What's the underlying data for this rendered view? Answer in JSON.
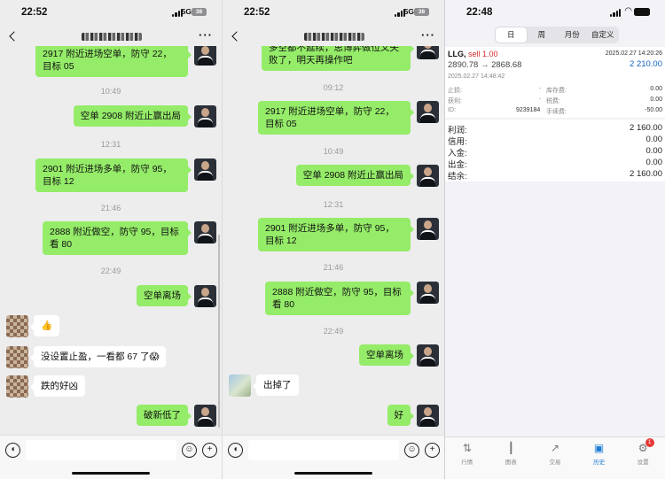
{
  "left_screen": {
    "status_time": "22:52",
    "network": "5G",
    "battery": "38",
    "more": "···",
    "timestamps": [
      "10:49",
      "12:31",
      "21:46",
      "22:49"
    ],
    "messages": [
      {
        "text": "2917 附近进场空单，防守 22，目标 05"
      },
      {
        "text": "空单 2908 附近止赢出局"
      },
      {
        "text": "2901 附近进场多单，防守 95，目标 12"
      },
      {
        "text": "2888 附近做空，防守 95，目标看 80"
      },
      {
        "text": "空单离场"
      },
      {
        "text": "👍"
      },
      {
        "text": "没设置止盈，一看都 67 了😱"
      },
      {
        "text": "跌的好凶"
      },
      {
        "text": "破新低了"
      }
    ]
  },
  "middle_screen": {
    "status_time": "22:52",
    "network": "5G",
    "battery": "38",
    "more": "···",
    "timestamps": [
      "09:12",
      "10:49",
      "12:31",
      "21:46",
      "22:49"
    ],
    "messages": [
      {
        "text": "多空都不延续，思博弈做位义失败了，明天再操作吧"
      },
      {
        "text": "2917 附近进场空单，防守 22，目标 05"
      },
      {
        "text": "空单 2908 附近止赢出局"
      },
      {
        "text": "2901 附近进场多单，防守 95，目标 12"
      },
      {
        "text": "2888 附近做空，防守 95，目标看 80"
      },
      {
        "text": "空单离场"
      },
      {
        "text": "出掉了"
      },
      {
        "text": "好"
      }
    ]
  },
  "right_screen": {
    "status_time": "22:48",
    "tabs": [
      "日",
      "周",
      "月份",
      "自定义"
    ],
    "active_tab": "日",
    "trade": {
      "symbol": "LLG,",
      "side": "sell 1.00",
      "price_move": "2890.78 → 2868.68",
      "close_time": "2025.02.27 14:20:26",
      "profit": "2 210.00",
      "open_time": "2025.02.27 14:48:42",
      "details_left": [
        {
          "label": "止损:",
          "value": "-"
        },
        {
          "label": "获利:",
          "value": "-"
        },
        {
          "label": "ID:",
          "value": "9239184"
        }
      ],
      "details_right": [
        {
          "label": "库存费:",
          "value": "0.00"
        },
        {
          "label": "税费:",
          "value": "0.00"
        },
        {
          "label": "手续费:",
          "value": "-50.00"
        }
      ]
    },
    "summary": [
      {
        "label": "利润:",
        "value": "2 160.00"
      },
      {
        "label": "信用:",
        "value": "0.00"
      },
      {
        "label": "入金:",
        "value": "0.00"
      },
      {
        "label": "出金:",
        "value": "0.00"
      },
      {
        "label": "结余:",
        "value": "2 160.00"
      }
    ],
    "bottom_nav": [
      {
        "label": "行情",
        "icon": "quotes-icon"
      },
      {
        "label": "图表",
        "icon": "chart-icon"
      },
      {
        "label": "交易",
        "icon": "trade-icon"
      },
      {
        "label": "历史",
        "icon": "history-icon"
      },
      {
        "label": "设置",
        "icon": "settings-icon"
      }
    ],
    "settings_badge": "1",
    "accent_color": "#1e7cd6"
  }
}
